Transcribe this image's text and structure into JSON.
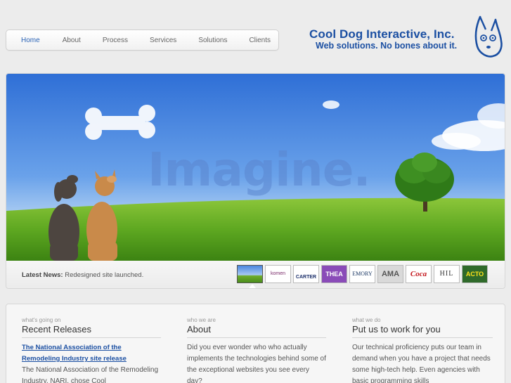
{
  "nav": {
    "items": [
      {
        "label": "Home",
        "active": true
      },
      {
        "label": "About",
        "active": false
      },
      {
        "label": "Process",
        "active": false
      },
      {
        "label": "Services",
        "active": false
      },
      {
        "label": "Solutions",
        "active": false
      },
      {
        "label": "Clients",
        "active": false
      }
    ]
  },
  "logo": {
    "name": "Cool Dog Interactive, Inc.",
    "tagline": "Web solutions. No bones about it."
  },
  "hero": {
    "headline": "Imagine."
  },
  "news": {
    "label": "Latest News:",
    "text": "Redesigned site launched."
  },
  "thumbnails": [
    {
      "name": "thumb-imagine",
      "text": ""
    },
    {
      "name": "thumb-komen",
      "text": "komen"
    },
    {
      "name": "thumb-carter",
      "text": "CARTER"
    },
    {
      "name": "thumb-theatre",
      "text": "THEA"
    },
    {
      "name": "thumb-emory",
      "text": "EMORY"
    },
    {
      "name": "thumb-ama",
      "text": "AMA"
    },
    {
      "name": "thumb-coca-cola",
      "text": "Coca"
    },
    {
      "name": "thumb-hill",
      "text": "HIL"
    },
    {
      "name": "thumb-actor",
      "text": "ACTO"
    }
  ],
  "columns": {
    "releases": {
      "kicker": "what's going on",
      "title": "Recent Releases",
      "link": "The National Association of the Remodeling Industry site release",
      "body": "The National Association of the Remodeling Industry, NARI, chose Cool"
    },
    "about": {
      "kicker": "who we are",
      "title": "About",
      "body": "Did you ever wonder who who actually implements the technologies behind some of the exceptional websites you see every day?"
    },
    "work": {
      "kicker": "what we do",
      "title": "Put us to work for you",
      "body": "Our technical proficiency puts our team in demand when you have a project that needs some high-tech help. Even agencies with basic programming skills"
    }
  },
  "colors": {
    "brand": "#1b4fa2",
    "nav_active": "#2b63b5",
    "background": "#ececec"
  }
}
